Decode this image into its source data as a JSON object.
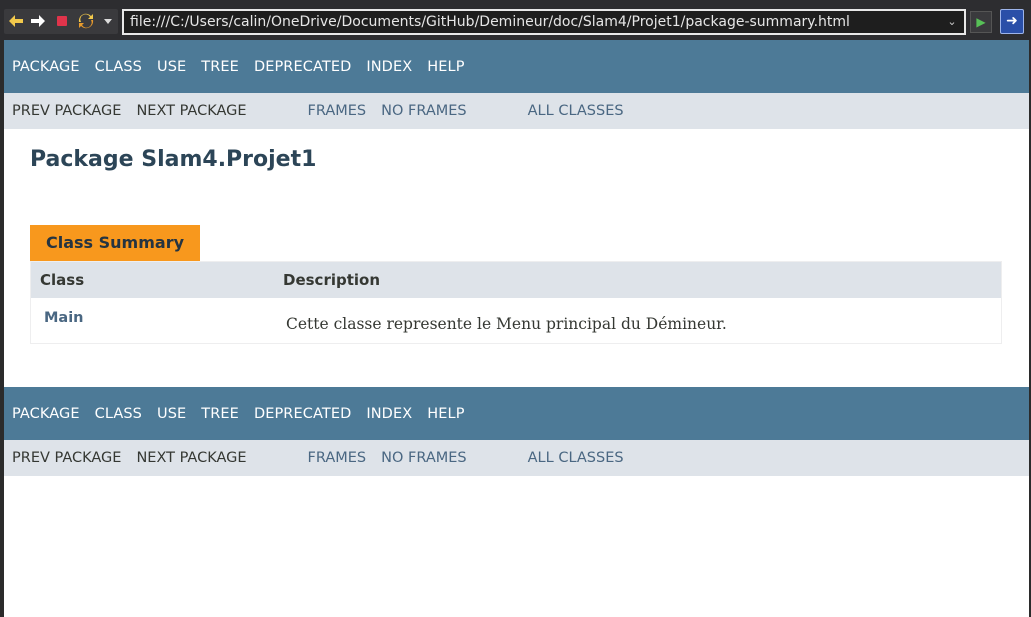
{
  "browser": {
    "address": "file:///C:/Users/calin/OneDrive/Documents/GitHub/Demineur/doc/Slam4/Projet1/package-summary.html",
    "icons": [
      "back-icon",
      "forward-icon",
      "stop-icon",
      "refresh-icon",
      "chevron-down-icon",
      "go-icon",
      "app-icon"
    ],
    "colors": {
      "toolbar": "#2d2d30",
      "address_border": "#e8e8e8",
      "go": "#57c157",
      "app": "#2a4fa8"
    }
  },
  "nav": {
    "items": [
      "PACKAGE",
      "CLASS",
      "USE",
      "TREE",
      "DEPRECATED",
      "INDEX",
      "HELP"
    ],
    "prev_package": "PREV PACKAGE",
    "next_package": "NEXT PACKAGE",
    "frames": "FRAMES",
    "no_frames": "NO FRAMES",
    "all_classes": "ALL CLASSES"
  },
  "page": {
    "title": "Package Slam4.Projet1",
    "summary_caption": "Class Summary",
    "columns": [
      "Class",
      "Description"
    ],
    "rows": [
      {
        "class": "Main",
        "description": "Cette classe represente le Menu principal du Démineur."
      }
    ]
  },
  "colors": {
    "nav_bg": "#4d7a97",
    "subnav_bg": "#dee3e9",
    "caption_bg": "#f8981d",
    "link": "#4a6782",
    "title": "#2c4557"
  }
}
